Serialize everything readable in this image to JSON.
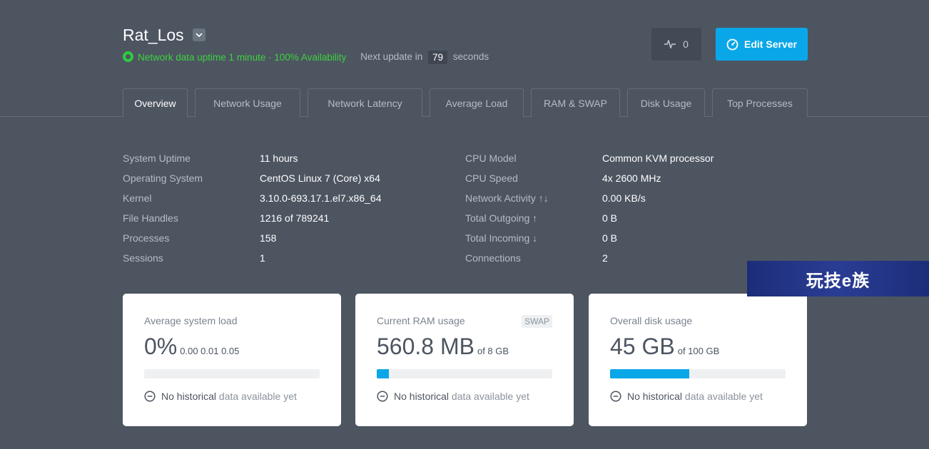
{
  "header": {
    "server_name": "Rat_Los",
    "status_text": "Network data uptime 1 minute · 100% Availability",
    "next_update_prefix": "Next update in",
    "countdown": "79",
    "next_update_suffix": "seconds"
  },
  "actions": {
    "pulse_count": "0",
    "edit_label": "Edit Server"
  },
  "tabs": [
    {
      "label": "Overview",
      "active": true
    },
    {
      "label": "Network Usage"
    },
    {
      "label": "Network Latency"
    },
    {
      "label": "Average Load"
    },
    {
      "label": "RAM & SWAP"
    },
    {
      "label": "Disk Usage"
    },
    {
      "label": "Top Processes"
    }
  ],
  "info_left": [
    {
      "label": "System Uptime",
      "value": "11 hours"
    },
    {
      "label": "Operating System",
      "value": "CentOS Linux 7 (Core) x64"
    },
    {
      "label": "Kernel",
      "value": "3.10.0-693.17.1.el7.x86_64"
    },
    {
      "label": "File Handles",
      "value": "1216 of 789241"
    },
    {
      "label": "Processes",
      "value": "158"
    },
    {
      "label": "Sessions",
      "value": "1"
    }
  ],
  "info_right": [
    {
      "label": "CPU Model",
      "value": "Common KVM processor"
    },
    {
      "label": "CPU Speed",
      "value": "4x 2600 MHz"
    },
    {
      "label": "Network Activity ↑↓",
      "value": "0.00 KB/s"
    },
    {
      "label": "Total Outgoing ↑",
      "value": "0 B"
    },
    {
      "label": "Total Incoming ↓",
      "value": "0 B"
    },
    {
      "label": "Connections",
      "value": "2"
    }
  ],
  "cards": {
    "load": {
      "title": "Average system load",
      "big": "0%",
      "sub": "0.00 0.01 0.05",
      "progress": 0,
      "no_hist_dark": "No historical",
      "no_hist_light": "data available yet"
    },
    "ram": {
      "title": "Current RAM usage",
      "badge": "SWAP",
      "big": "560.8 MB",
      "sub": "of 8 GB",
      "progress": 0.07,
      "no_hist_dark": "No historical",
      "no_hist_light": "data available yet"
    },
    "disk": {
      "title": "Overall disk usage",
      "big": "45 GB",
      "sub": "of 100 GB",
      "progress": 0.45,
      "no_hist_dark": "No historical",
      "no_hist_light": "data available yet"
    }
  },
  "watermark": "玩技e族",
  "colors": {
    "background": "#4d5561",
    "accent": "#0aa7e8",
    "status_green": "#3dd13f"
  }
}
